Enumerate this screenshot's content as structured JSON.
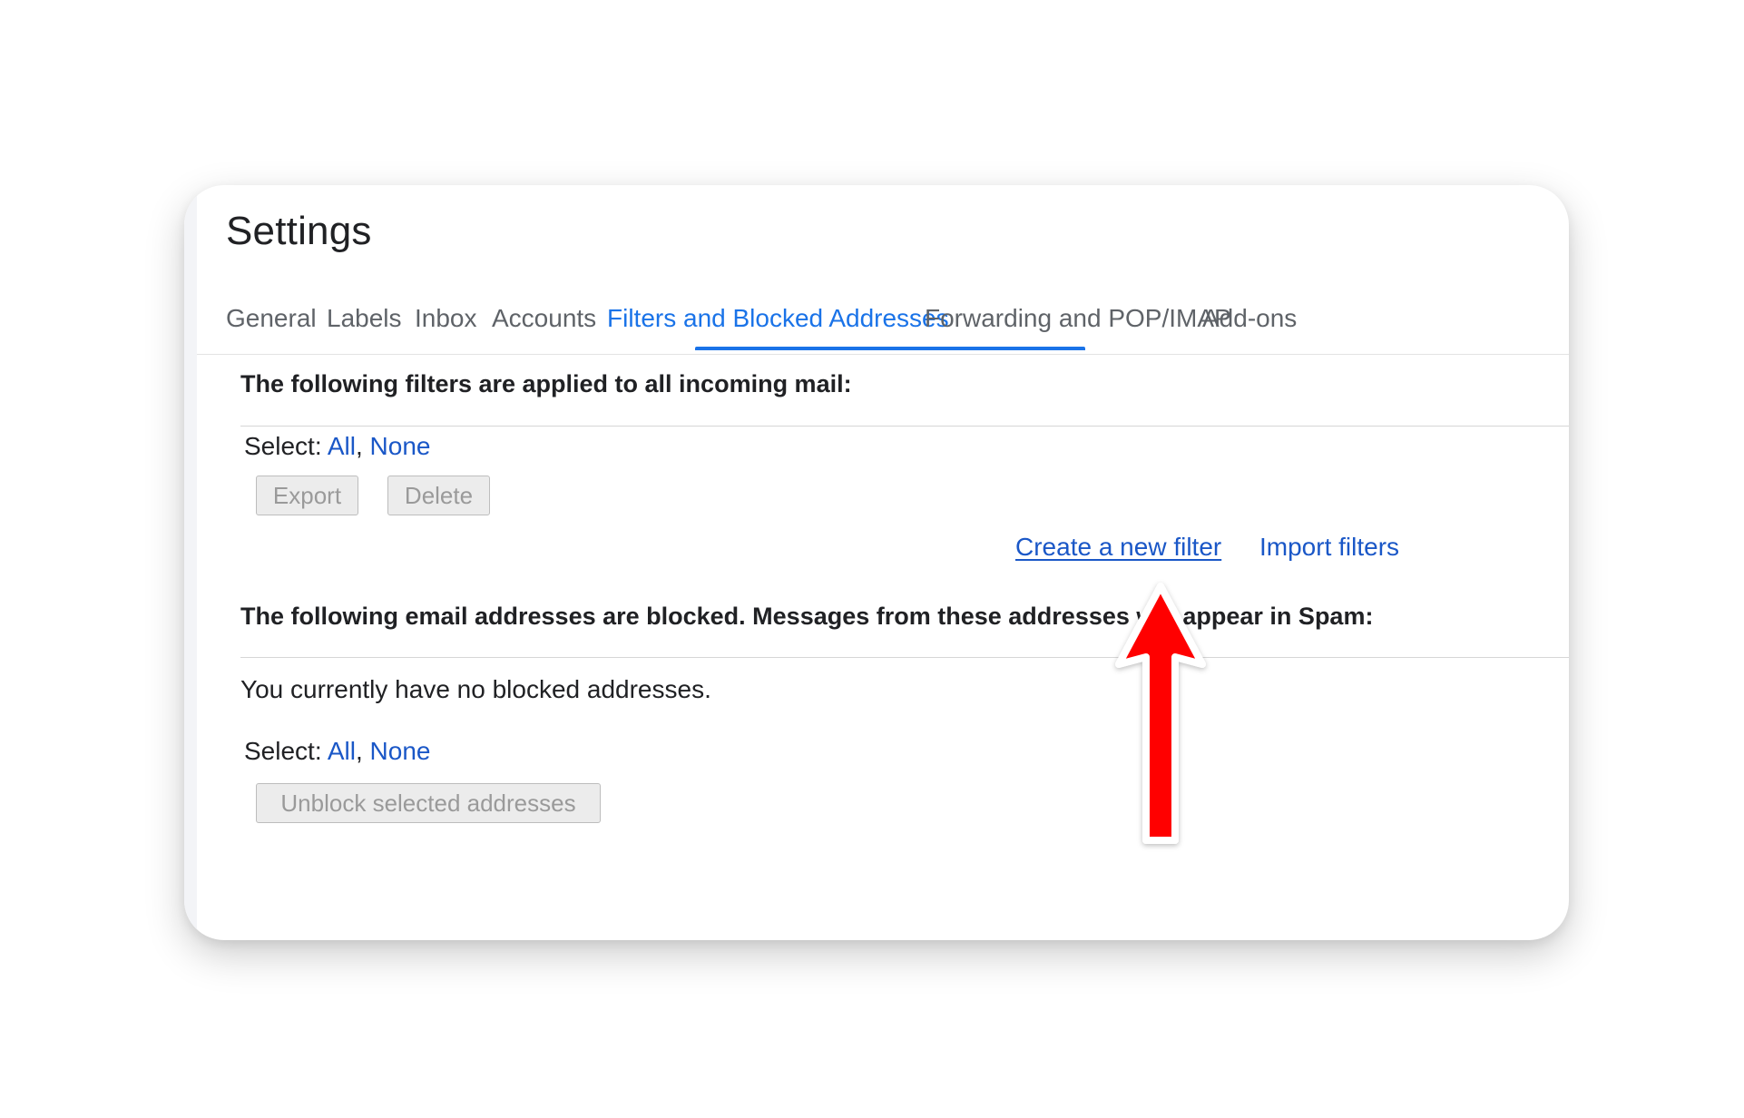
{
  "settings": {
    "title": "Settings"
  },
  "tabs": [
    {
      "label": "General"
    },
    {
      "label": "Labels"
    },
    {
      "label": "Inbox"
    },
    {
      "label": "Accounts"
    },
    {
      "label": "Filters and Blocked Addresses",
      "active": true
    },
    {
      "label": "Forwarding and POP/IMAP"
    },
    {
      "label": "Add-ons"
    }
  ],
  "filters": {
    "heading": "The following filters are applied to all incoming mail:",
    "select_label": "Select:",
    "select_all": "All",
    "separator": ",",
    "select_none": "None",
    "export_label": "Export",
    "delete_label": "Delete",
    "create_filter_label": "Create a new filter",
    "import_filters_label": "Import filters"
  },
  "blocked": {
    "heading": "The following email addresses are blocked. Messages from these addresses will appear in Spam:",
    "empty_message": "You currently have no blocked addresses.",
    "select_label": "Select:",
    "select_all": "All",
    "separator": ",",
    "select_none": "None",
    "unblock_label": "Unblock selected addresses"
  },
  "colors": {
    "accent": "#1a73e8",
    "link": "#1a57c7",
    "annotation_arrow": "#ff0000"
  },
  "icons": {
    "annotation": "red-up-arrow-icon"
  }
}
